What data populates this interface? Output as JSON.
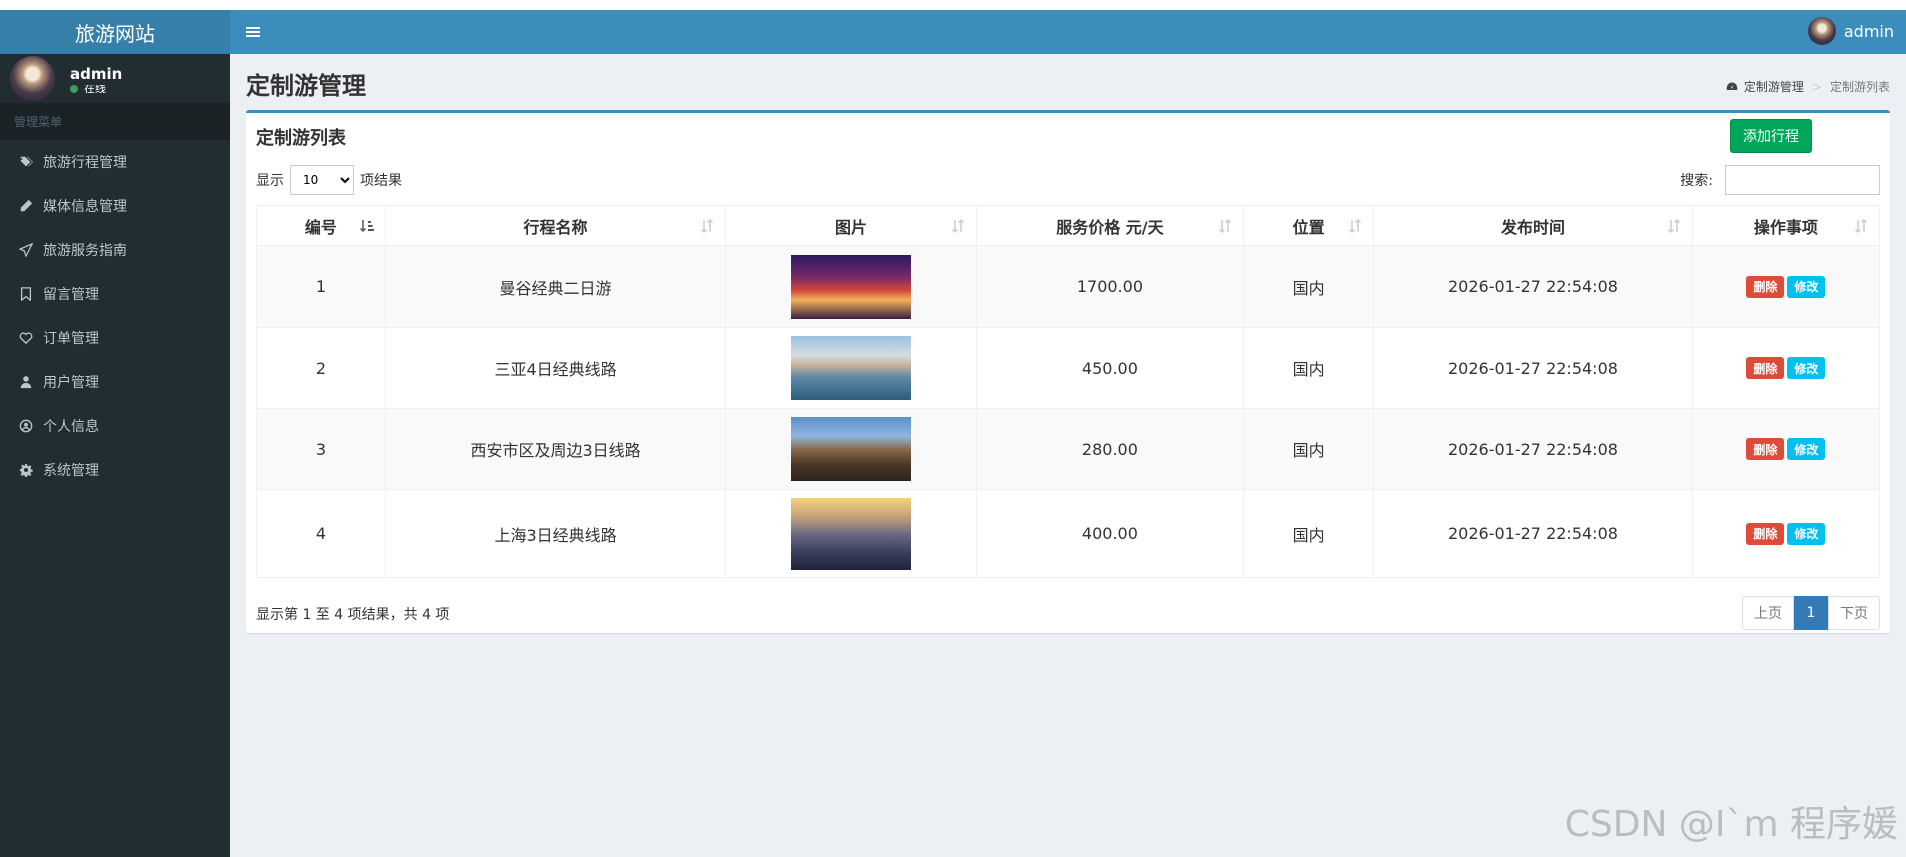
{
  "sidebar": {
    "logo": "旅游网站",
    "user": {
      "name": "admin",
      "status": "在线"
    },
    "menu_header": "管理菜单",
    "items": [
      {
        "label": "旅游行程管理",
        "icon": "tags-icon"
      },
      {
        "label": "媒体信息管理",
        "icon": "pencil-icon"
      },
      {
        "label": "旅游服务指南",
        "icon": "paper-plane-icon"
      },
      {
        "label": "留言管理",
        "icon": "bookmark-icon"
      },
      {
        "label": "订单管理",
        "icon": "heart-icon"
      },
      {
        "label": "用户管理",
        "icon": "user-icon"
      },
      {
        "label": "个人信息",
        "icon": "user-circle-icon"
      },
      {
        "label": "系统管理",
        "icon": "gear-icon"
      }
    ]
  },
  "topbar": {
    "menu_glyph": "≡",
    "user_name": "admin"
  },
  "header": {
    "title": "定制游管理",
    "breadcrumb": {
      "parent": "定制游管理",
      "sep": ">",
      "current": "定制游列表"
    }
  },
  "box": {
    "title": "定制游列表",
    "add_button": "添加行程",
    "length": {
      "prefix": "显示",
      "value": "10",
      "suffix": "项结果"
    },
    "search": {
      "label": "搜索:",
      "value": ""
    }
  },
  "table": {
    "headers": [
      "编号",
      "行程名称",
      "图片",
      "服务价格 元/天",
      "位置",
      "发布时间",
      "操作事项"
    ],
    "rows": [
      {
        "id": "1",
        "name": "曼谷经典二日游",
        "price": "1700.00",
        "location": "国内",
        "time": "2026-01-27 22:54:08",
        "del": "删除",
        "edit": "修改"
      },
      {
        "id": "2",
        "name": "三亚4日经典线路",
        "price": "450.00",
        "location": "国内",
        "time": "2026-01-27 22:54:08",
        "del": "删除",
        "edit": "修改"
      },
      {
        "id": "3",
        "name": "西安市区及周边3日线路",
        "price": "280.00",
        "location": "国内",
        "time": "2026-01-27 22:54:08",
        "del": "删除",
        "edit": "修改"
      },
      {
        "id": "4",
        "name": "上海3日经典线路",
        "price": "400.00",
        "location": "国内",
        "time": "2026-01-27 22:54:08",
        "del": "删除",
        "edit": "修改"
      }
    ]
  },
  "footer": {
    "info": "显示第 1 至 4 项结果，共 4 项",
    "pager": {
      "prev": "上页",
      "current": "1",
      "next": "下页"
    }
  },
  "watermark": "CSDN @I`m 程序媛"
}
